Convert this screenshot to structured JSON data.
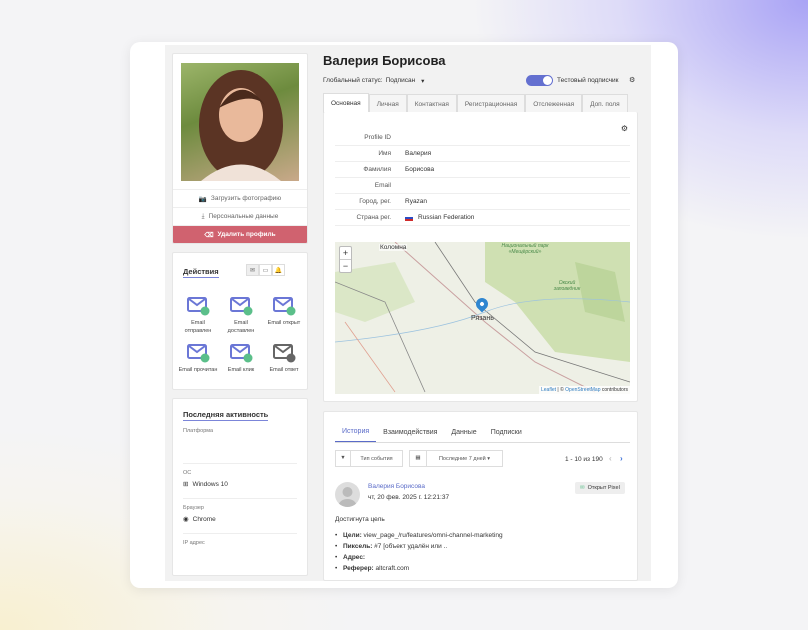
{
  "profile": {
    "name": "Валерия Борисова",
    "status_label": "Глобальный статус:",
    "status_value": "Подписан",
    "test_label": "Тестовый подписчик",
    "test_on": true
  },
  "left": {
    "upload_photo": "Загрузить фотографию",
    "personal_data": "Персональные данные",
    "delete_profile": "Удалить профиль"
  },
  "actions": {
    "title": "Действия",
    "items": [
      {
        "label": "Email отправлен"
      },
      {
        "label": "Email доставлен"
      },
      {
        "label": "Email открыт"
      },
      {
        "label": "Email прочитан"
      },
      {
        "label": "Email клик"
      },
      {
        "label": "Email ответ"
      }
    ]
  },
  "activity": {
    "title": "Последняя активность",
    "fields": [
      {
        "label": "Платформа",
        "value": ""
      },
      {
        "label": "ОС",
        "value": "Windows 10"
      },
      {
        "label": "Браузер",
        "value": "Chrome"
      },
      {
        "label": "IP адрес",
        "value": ""
      }
    ]
  },
  "tabs": [
    "Основная",
    "Личная",
    "Контактная",
    "Регистрационная",
    "Отслеженная",
    "Доп. поля"
  ],
  "fields": [
    {
      "k": "Profile ID",
      "v": ""
    },
    {
      "k": "Имя",
      "v": "Валерия"
    },
    {
      "k": "Фамилия",
      "v": "Борисова"
    },
    {
      "k": "Email",
      "v": ""
    },
    {
      "k": "Город, рег.",
      "v": "Ryazan"
    },
    {
      "k": "Страна рег.",
      "v": "Russian Federation"
    }
  ],
  "map": {
    "city": "Рязань",
    "kolomna": "Коломна",
    "park": "Национальный парк «Мещёрский»",
    "reserve": "Окский заповедник",
    "zoom_in": "+",
    "zoom_out": "−",
    "attr_leaflet": "Leaflet",
    "attr_sep": " | © ",
    "attr_osm": "OpenStreetMap",
    "attr_tail": " contributors"
  },
  "history": {
    "tabs": [
      "История",
      "Взаимодействия",
      "Данные",
      "Подписки"
    ],
    "filter_type": "Тип события",
    "filter_period": "Последние 7 дней",
    "pagination": "1 - 10 из 190",
    "event": {
      "user": "Валерия Борисова",
      "date": "чт, 20 фев. 2025 г. 12:21:37",
      "badge": "Открыт Pixel",
      "title": "Достигнута цель",
      "items": [
        {
          "k": "Цели:",
          "v": " view_page_/ru/features/omni-channel-marketing"
        },
        {
          "k": "Пиксель:",
          "v": " #7 [объект удалён или .."
        },
        {
          "k": "Адрес:",
          "v": ""
        },
        {
          "k": "Реферер:",
          "v": " altcraft.com"
        }
      ]
    }
  },
  "colors": {
    "accent": "#5a6bc8",
    "danger": "#d0626f",
    "toggle": "#6470d0"
  }
}
